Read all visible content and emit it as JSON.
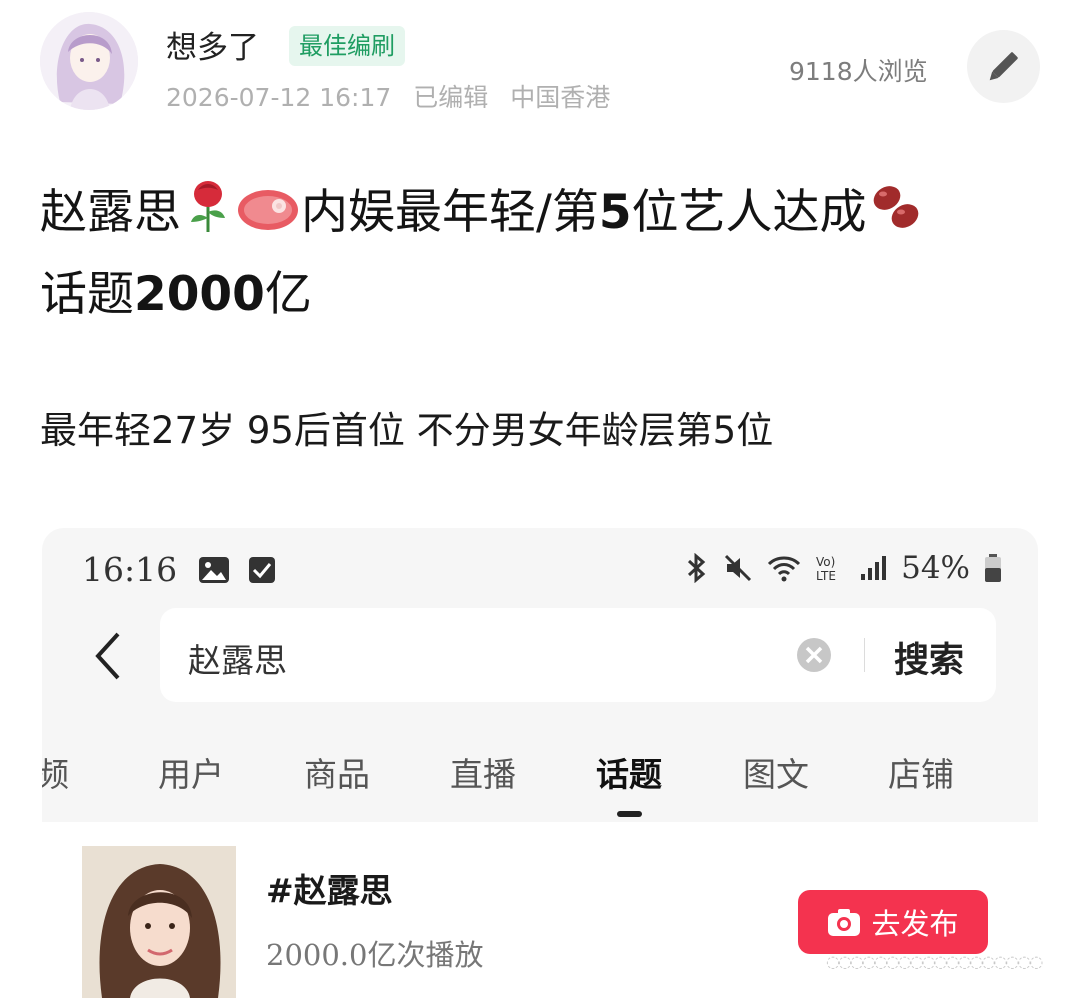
{
  "post": {
    "author": "想多了",
    "badge": "最佳编刷",
    "date": "2026-07-12 16:17",
    "edited": "已编辑",
    "location": "中国香港",
    "views": "9118人浏览",
    "title_part1": "赵露思",
    "title_part2": "内娱最年轻/第",
    "title_num1": "5",
    "title_part3": "位艺人达成",
    "title_part4": "话题",
    "title_num2": "2000",
    "title_part5": "亿",
    "subtitle": "最年轻27岁 95后首位 不分男女年龄层第5位"
  },
  "screenshot": {
    "time": "16:16",
    "battery": "54%",
    "search_query": "赵露思",
    "search_button": "搜索",
    "tabs": [
      "频",
      "用户",
      "商品",
      "直播",
      "话题",
      "图文",
      "店铺"
    ],
    "active_tab": "话题",
    "result": {
      "topic": "#赵露思",
      "plays": "2000.0亿次播放",
      "publish_button": "去发布"
    }
  },
  "colors": {
    "badge_green": "#1f9d62",
    "publish_red": "#f4334f"
  }
}
